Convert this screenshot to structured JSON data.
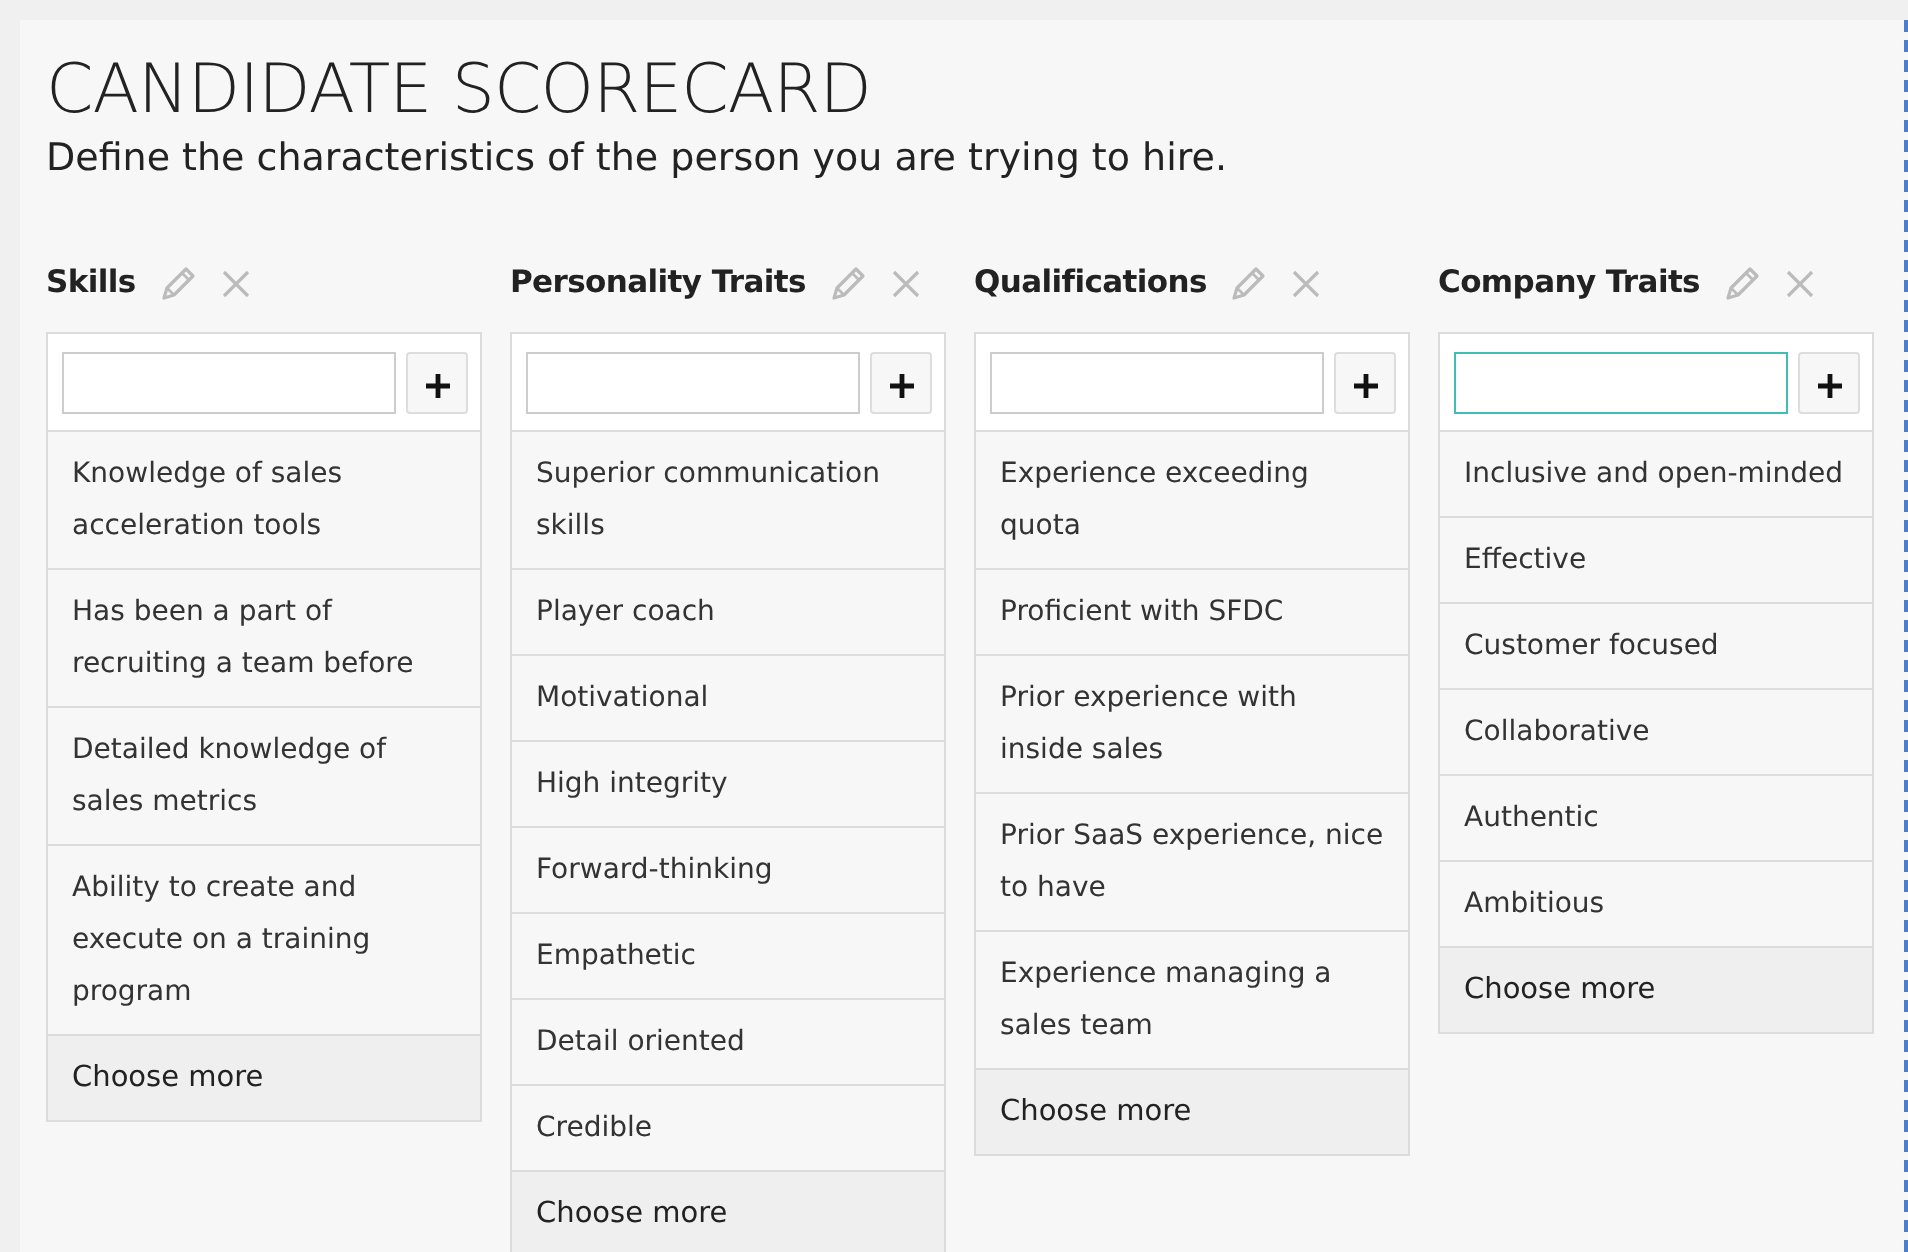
{
  "title": "CANDIDATE SCORECARD",
  "subtitle": "Define the characteristics of the person you are trying to hire.",
  "columns": [
    {
      "heading": "Skills",
      "focused": false,
      "items": [
        "Knowledge of sales acceleration tools",
        "Has been a part of recruiting a team before",
        "Detailed knowledge of sales metrics",
        "Ability to create and execute on a training program"
      ],
      "more": "Choose more"
    },
    {
      "heading": "Personality Traits",
      "focused": false,
      "items": [
        "Superior communication skills",
        "Player coach",
        "Motivational",
        "High integrity",
        "Forward-thinking",
        "Empathetic",
        "Detail oriented",
        "Credible"
      ],
      "more": "Choose more"
    },
    {
      "heading": "Qualifications",
      "focused": false,
      "items": [
        "Experience exceeding quota",
        "Proficient with SFDC",
        "Prior experience with inside sales",
        "Prior SaaS experience, nice to have",
        "Experience managing a sales team"
      ],
      "more": "Choose more"
    },
    {
      "heading": "Company Traits",
      "focused": true,
      "items": [
        "Inclusive and open-minded",
        "Effective",
        "Customer focused",
        "Collaborative",
        "Authentic",
        "Ambitious"
      ],
      "more": "Choose more"
    }
  ]
}
